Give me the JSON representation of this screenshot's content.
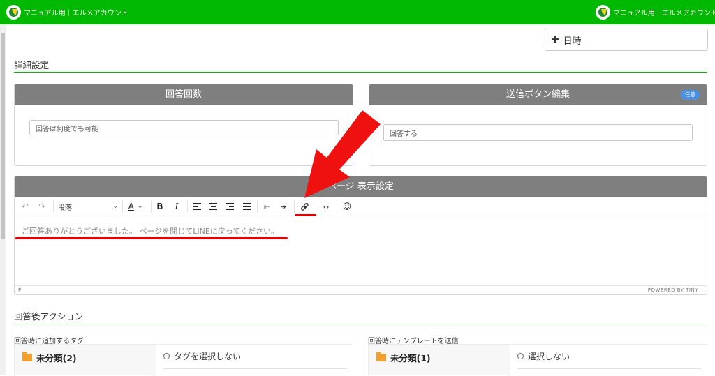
{
  "header": {
    "account_name": "マニュアル用｜エルメアカウント"
  },
  "date_button": {
    "label": "日時",
    "icon": "plus-icon"
  },
  "details": {
    "heading": "詳細設定",
    "answer_count": {
      "header": "回答回数",
      "value": "回答は何度でも可能"
    },
    "submit_button": {
      "header": "送信ボタン編集",
      "badge": "任意",
      "value": "回答する"
    }
  },
  "thanks_page": {
    "header": "ページ 表示設定",
    "toolbar": {
      "block_format": "段落",
      "buttons": [
        "undo",
        "redo",
        "text-color",
        "bold",
        "italic",
        "align-left",
        "align-center",
        "align-right",
        "align-justify",
        "outdent",
        "indent",
        "link",
        "source-code",
        "emoticons"
      ]
    },
    "body_text": "ご回答ありがとうございました。 ページを閉じてLINEに戻ってください。",
    "status_path": "P",
    "status_brand": "POWERED BY TINY"
  },
  "post_actions": {
    "heading": "回答後アクション",
    "tag_section": {
      "label": "回答時に追加するタグ",
      "folder": "未分類(2)",
      "option": "タグを選択しない"
    },
    "template_section": {
      "label": "回答時にテンプレートを送信",
      "folder": "未分類(1)",
      "option": "選択しない"
    }
  },
  "colors": {
    "brand_green": "#00b900",
    "card_header": "#7f7f7f",
    "annotation_red": "#e80000",
    "badge_blue": "#4a90e2"
  }
}
